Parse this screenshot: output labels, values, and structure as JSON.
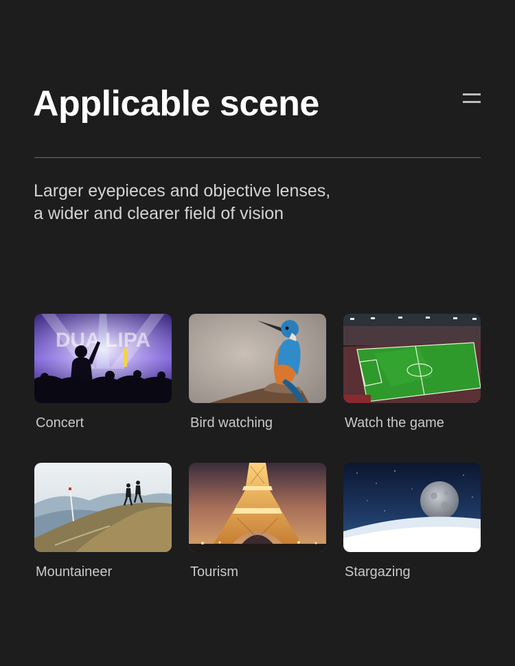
{
  "header": {
    "title": "Applicable scene",
    "menu_icon": "menu-icon"
  },
  "subtitle": {
    "line1": "Larger eyepieces and objective lenses,",
    "line2": "a wider and clearer field of vision"
  },
  "scenes": [
    {
      "label": "Concert",
      "icon": "concert-photo"
    },
    {
      "label": "Bird watching",
      "icon": "kingfisher-photo"
    },
    {
      "label": "Watch the game",
      "icon": "stadium-photo"
    },
    {
      "label": "Mountaineer",
      "icon": "mountain-hikers-photo"
    },
    {
      "label": "Tourism",
      "icon": "eiffel-tower-photo"
    },
    {
      "label": "Stargazing",
      "icon": "moon-photo"
    }
  ],
  "colors": {
    "background": "#1d1d1e",
    "title": "#ffffff",
    "text": "#d4d4d6",
    "divider": "#6e6e70"
  }
}
